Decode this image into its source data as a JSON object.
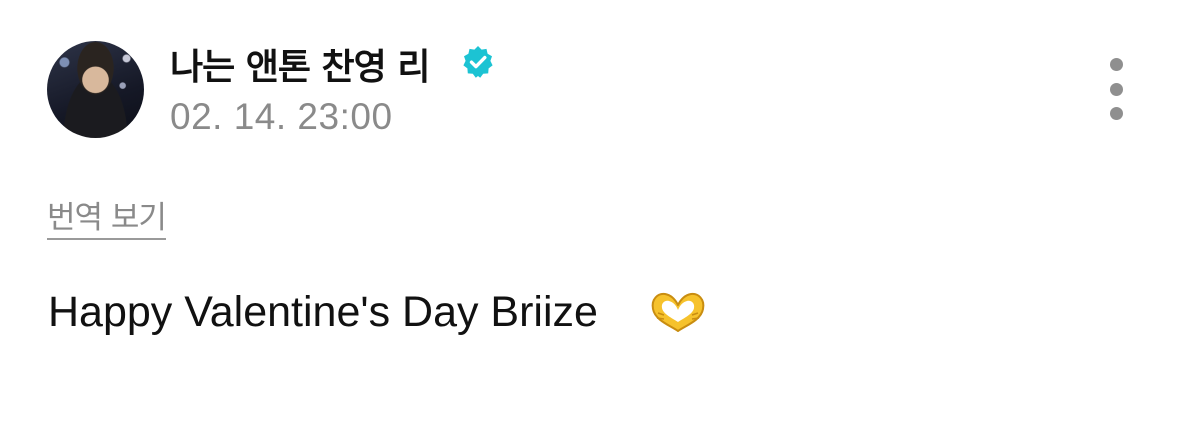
{
  "post": {
    "author": {
      "name": "나는 앤톤 찬영 리",
      "verified": true
    },
    "timestamp": "02. 14. 23:00",
    "translate_label": "번역 보기",
    "body_text": "Happy Valentine's Day Briize",
    "emoji_icon": "heart-hands-icon",
    "more_icon": "more-vertical-icon"
  },
  "colors": {
    "text_primary": "#111111",
    "text_secondary": "#8a8a8a",
    "verified_badge": "#1cc3d3",
    "emoji_yellow": "#f6c22c"
  }
}
